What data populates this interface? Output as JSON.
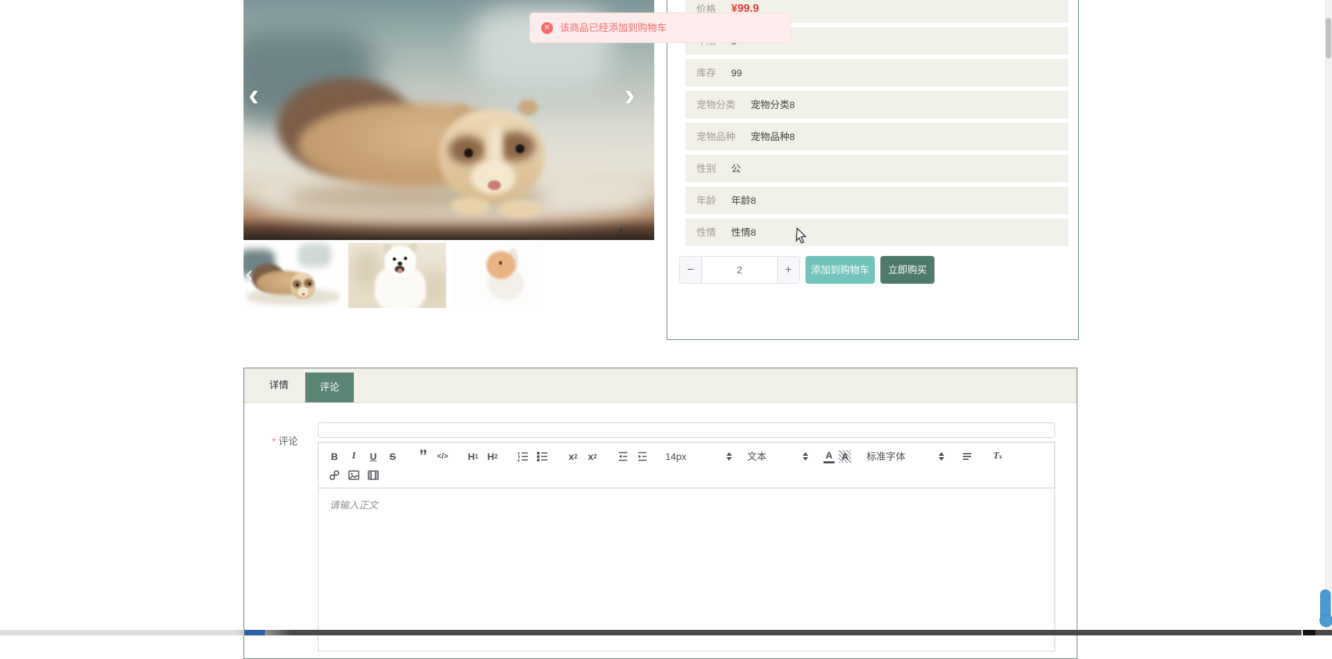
{
  "toast": {
    "message": "该商品已经添加到购物车"
  },
  "product": {
    "rows": [
      {
        "label": "价格",
        "value": "¥99.9"
      },
      {
        "label": "年限",
        "value": "8"
      },
      {
        "label": "库存",
        "value": "99"
      },
      {
        "label": "宠物分类",
        "value": "宠物分类8"
      },
      {
        "label": "宠物品种",
        "value": "宠物品种8"
      },
      {
        "label": "性别",
        "value": "公"
      },
      {
        "label": "年龄",
        "value": "年龄8"
      },
      {
        "label": "性情",
        "value": "性情8"
      }
    ],
    "quantity": {
      "value": "2",
      "minus": "−",
      "plus": "+"
    },
    "add_to_cart_label": "添加到购物车",
    "buy_now_label": "立即购买"
  },
  "gallery": {
    "prev": "‹",
    "next": "›",
    "thumb_prev": "‹",
    "thumbs": [
      "ferret-photo",
      "samoyed-dog-photo",
      "lop-rabbit-photo"
    ]
  },
  "tabs": {
    "detail": "详情",
    "comment": "评论"
  },
  "comment_form": {
    "required_mark": "*",
    "label": "评论",
    "editor": {
      "placeholder": "请输入正文",
      "toolbar": {
        "bold": "B",
        "italic": "I",
        "underline": "U",
        "strike": "S",
        "quote": "”",
        "code": "</>",
        "h": "H",
        "h1_num": "1",
        "h2_num": "2",
        "sub_base": "x",
        "sub_num": "2",
        "sup_base": "x",
        "sup_num": "2",
        "size_value": "14px",
        "header_value": "文本",
        "color_letter": "A",
        "background_letter": "A",
        "font_value": "标准字体",
        "clean_base": "T",
        "clean_x": "x"
      }
    }
  },
  "colors": {
    "accent_green": "#5a8473",
    "teal_button": "#72c3b9",
    "dark_green_button": "#4e7b69",
    "toast_bg": "#fdecec",
    "toast_text": "#f56c6c",
    "row_bg": "#f1f0e9",
    "price_red": "#e23c3c",
    "scroll_widget_blue": "#4a9bd4"
  }
}
